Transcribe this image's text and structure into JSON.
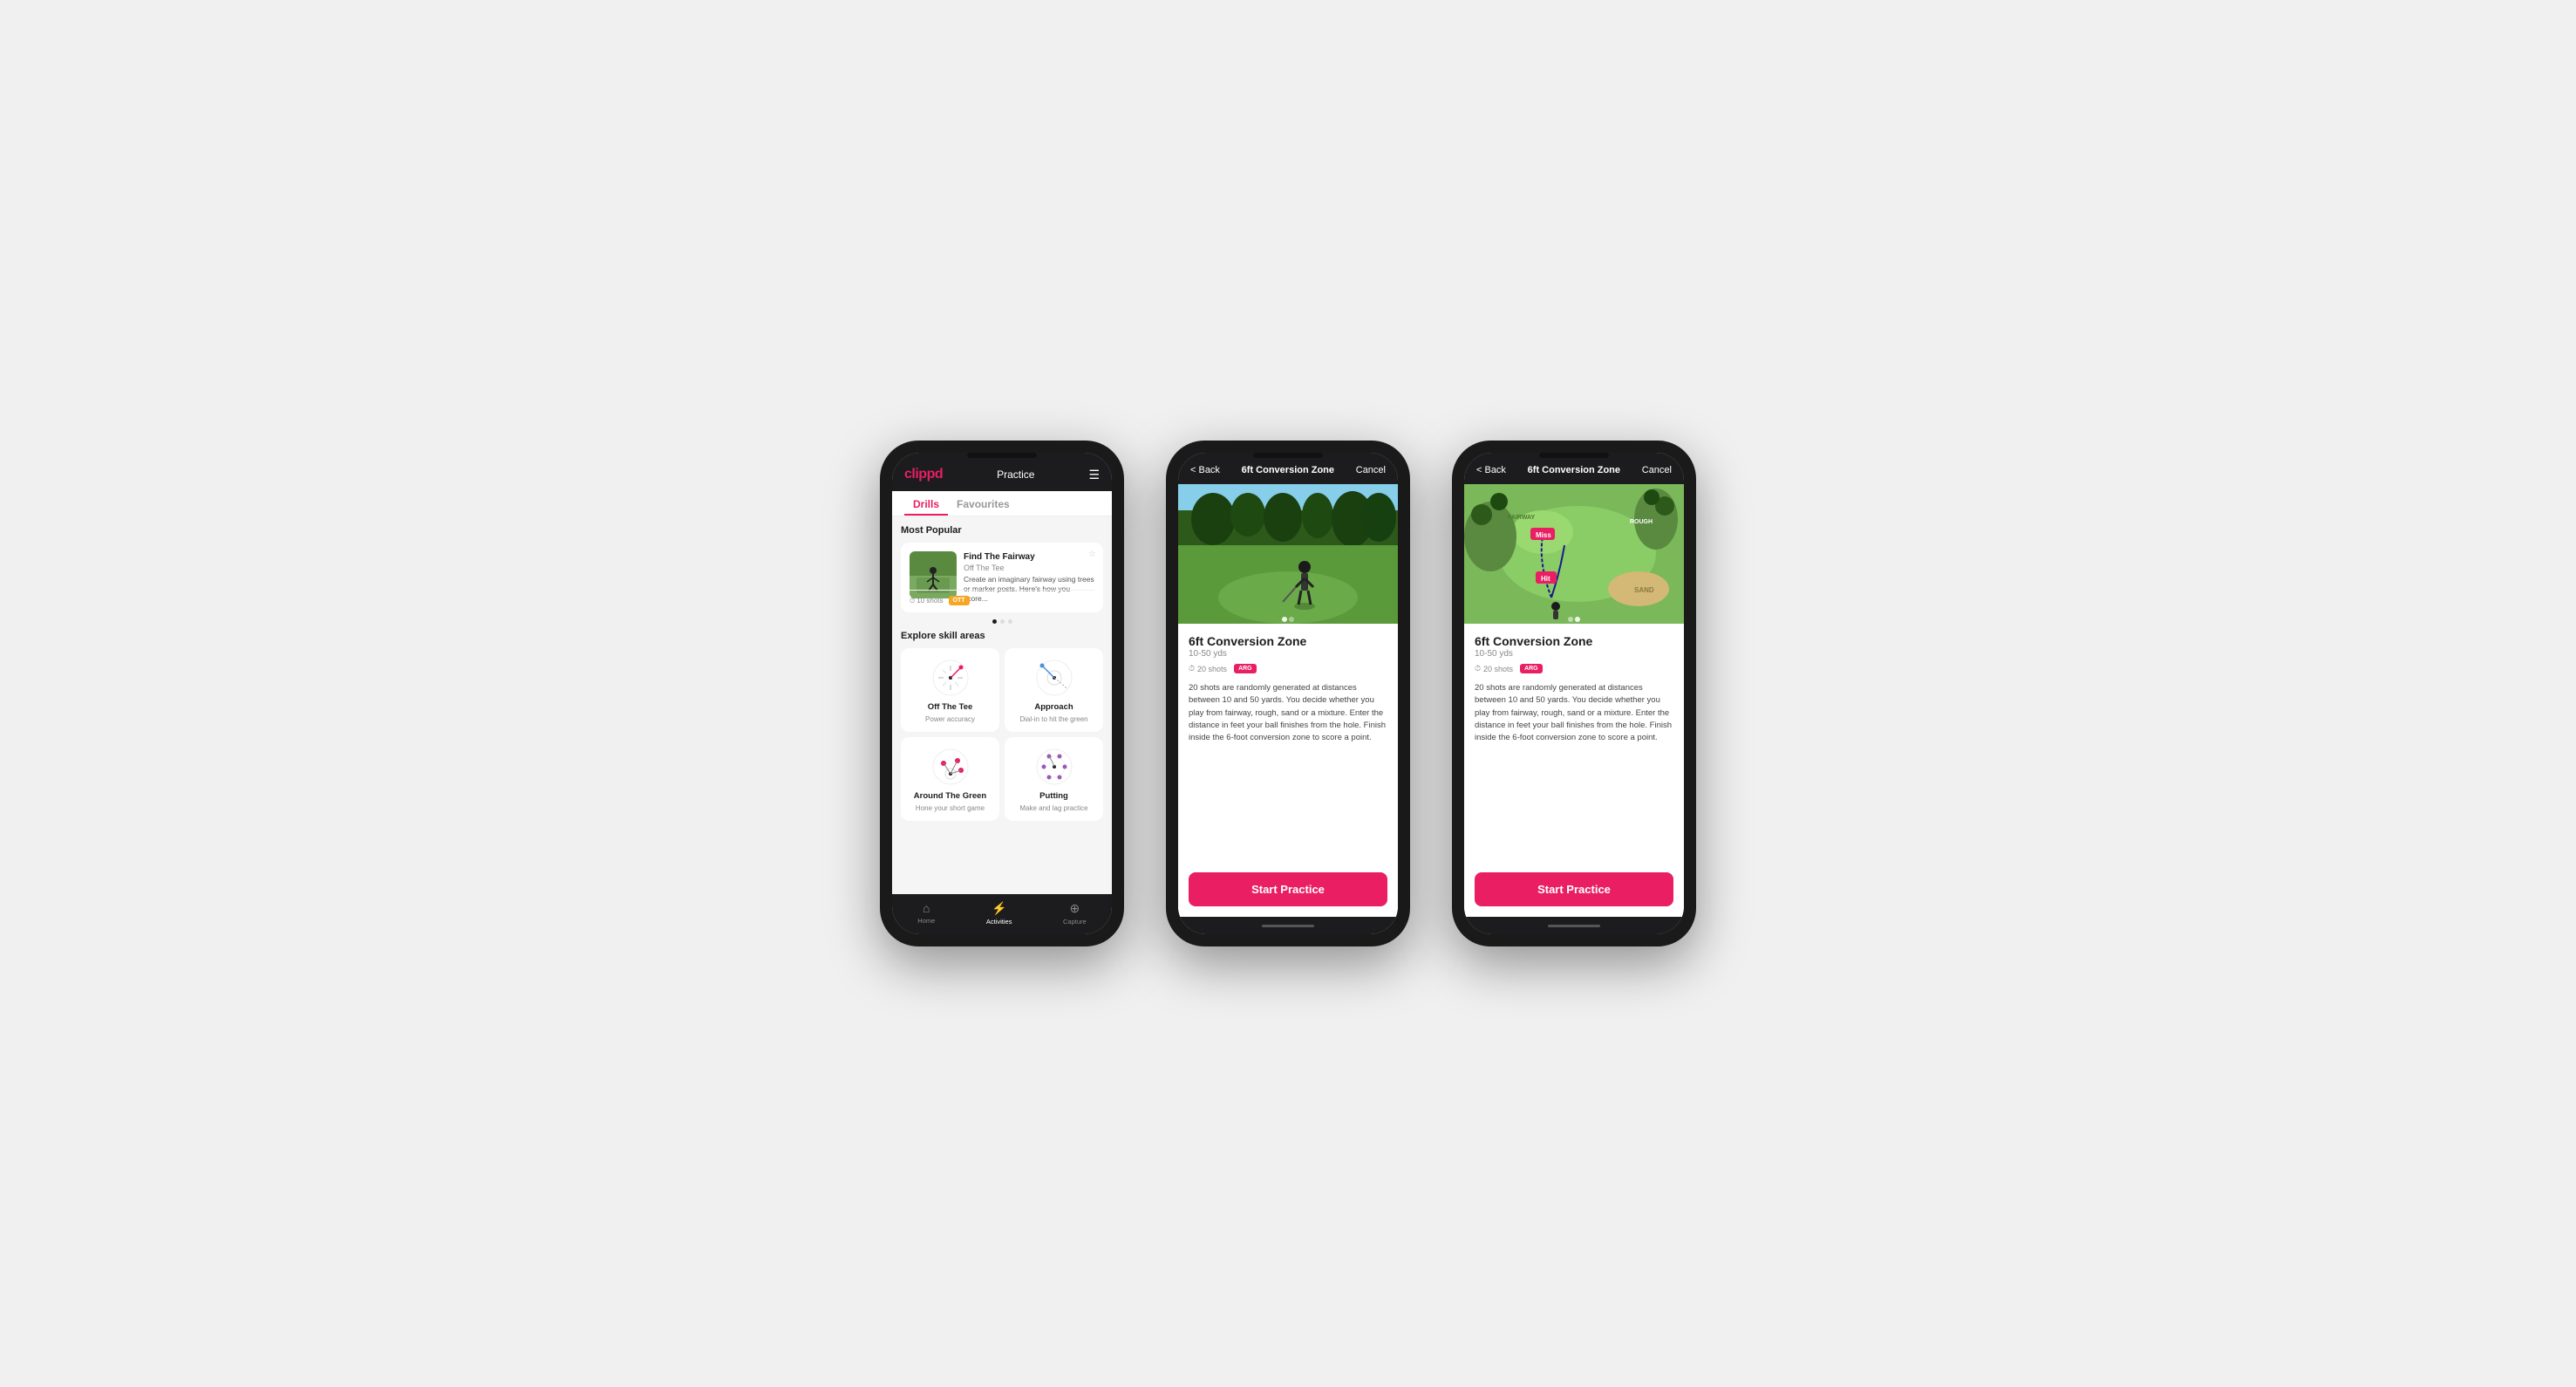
{
  "phone1": {
    "header": {
      "logo": "clippd",
      "title": "Practice",
      "menu_icon": "☰"
    },
    "tabs": [
      {
        "label": "Drills",
        "active": true
      },
      {
        "label": "Favourites",
        "active": false
      }
    ],
    "most_popular_label": "Most Popular",
    "featured_drill": {
      "name": "Find The Fairway",
      "sub": "Off The Tee",
      "description": "Create an imaginary fairway using trees or marker posts. Here's how you score...",
      "shots": "10 shots",
      "tag": "OTT",
      "thumb_emoji": "⛳"
    },
    "explore_label": "Explore skill areas",
    "skills": [
      {
        "name": "Off The Tee",
        "desc": "Power accuracy"
      },
      {
        "name": "Approach",
        "desc": "Dial-in to hit the green"
      },
      {
        "name": "Around The Green",
        "desc": "Hone your short game"
      },
      {
        "name": "Putting",
        "desc": "Make and lag practice"
      }
    ],
    "nav": [
      {
        "label": "Home",
        "icon": "⌂",
        "active": false
      },
      {
        "label": "Activities",
        "icon": "⚡",
        "active": true
      },
      {
        "label": "Capture",
        "icon": "⊕",
        "active": false
      }
    ]
  },
  "phone2": {
    "header": {
      "back": "< Back",
      "title": "6ft Conversion Zone",
      "cancel": "Cancel"
    },
    "drill": {
      "name": "6ft Conversion Zone",
      "range": "10-50 yds",
      "shots": "20 shots",
      "tag": "ARG",
      "description": "20 shots are randomly generated at distances between 10 and 50 yards. You decide whether you play from fairway, rough, sand or a mixture. Enter the distance in feet your ball finishes from the hole. Finish inside the 6-foot conversion zone to score a point."
    },
    "start_btn": "Start Practice"
  },
  "phone3": {
    "header": {
      "back": "< Back",
      "title": "6ft Conversion Zone",
      "cancel": "Cancel"
    },
    "drill": {
      "name": "6ft Conversion Zone",
      "range": "10-50 yds",
      "shots": "20 shots",
      "tag": "ARG",
      "description": "20 shots are randomly generated at distances between 10 and 50 yards. You decide whether you play from fairway, rough, sand or a mixture. Enter the distance in feet your ball finishes from the hole. Finish inside the 6-foot conversion zone to score a point."
    },
    "start_btn": "Start Practice"
  }
}
